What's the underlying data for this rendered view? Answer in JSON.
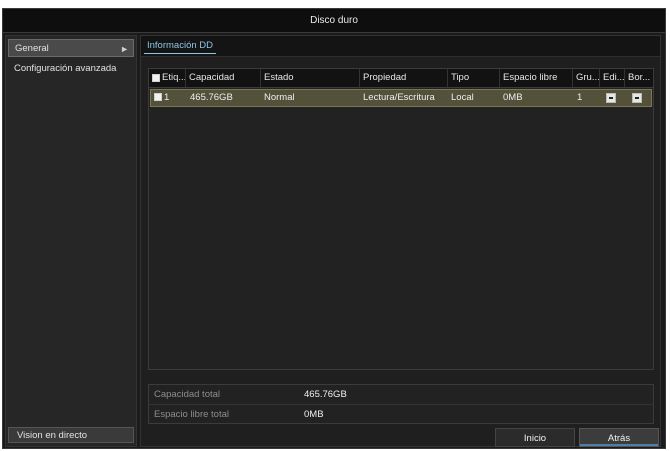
{
  "window": {
    "title": "Disco duro"
  },
  "sidebar": {
    "items": [
      {
        "label": "General",
        "active": true
      },
      {
        "label": "Configuración avanzada",
        "active": false
      }
    ],
    "bottom_button": "Vision en directo"
  },
  "tabs": [
    {
      "label": "Información DD"
    }
  ],
  "table": {
    "columns": [
      "Etiq...",
      "Capacidad",
      "Estado",
      "Propiedad",
      "Tipo",
      "Espacio libre",
      "Gru...",
      "Edi...",
      "Bor..."
    ],
    "rows": [
      {
        "label": "1",
        "capacidad": "465.76GB",
        "estado": "Normal",
        "propiedad": "Lectura/Escritura",
        "tipo": "Local",
        "espacio_libre": "0MB",
        "grupo": "1"
      }
    ]
  },
  "summary": {
    "capacidad_total_label": "Capacidad total",
    "capacidad_total_value": "465.76GB",
    "espacio_libre_label": "Espacio libre total",
    "espacio_libre_value": "0MB"
  },
  "buttons": {
    "inicio": "Inicio",
    "atras": "Atrás"
  },
  "colors": {
    "selected_row": "#54513a",
    "tab_accent": "#8ec6e6",
    "background": "#1b1b1b"
  },
  "icons": {
    "sidebar_arrow": "chevron-right-icon",
    "edit": "edit-icon",
    "delete": "delete-icon"
  }
}
